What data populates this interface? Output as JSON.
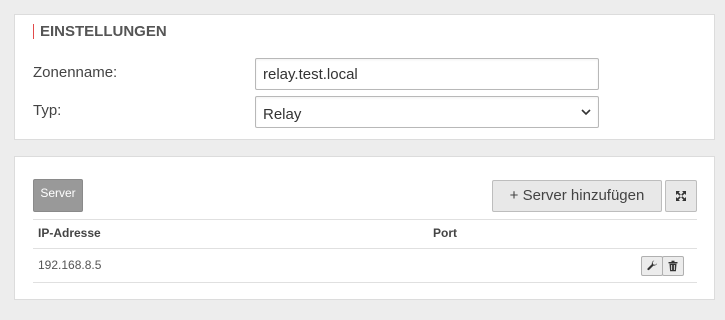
{
  "settings": {
    "title": "EINSTELLUNGEN",
    "zone_label": "Zonenname:",
    "zone_value": "relay.test.local",
    "type_label": "Typ:",
    "type_value": "Relay"
  },
  "servers": {
    "tab_label": "Server",
    "add_button_label": "+ Server hinzufügen",
    "expand_icon": "expand-icon",
    "columns": [
      "IP-Adresse",
      "Port"
    ],
    "rows": [
      {
        "ip": "192.168.8.5",
        "port": ""
      }
    ],
    "row_actions": [
      "wrench-icon",
      "trash-icon"
    ]
  },
  "colors": {
    "background": "#ededed",
    "panel": "#ffffff",
    "title_accent": "#e24a4a",
    "tab_active": "#999999"
  }
}
